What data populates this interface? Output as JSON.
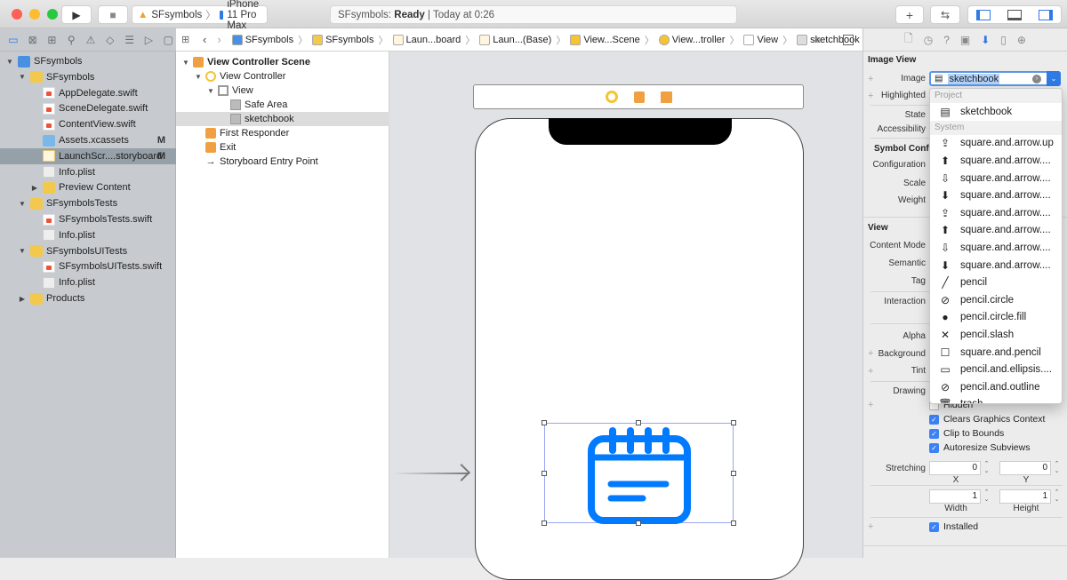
{
  "titlebar": {
    "scheme": {
      "project": "SFsymbols",
      "device": "iPhone 11 Pro Max"
    },
    "status": {
      "project": "SFsymbols:",
      "state": "Ready",
      "time": "| Today at 0:26"
    },
    "buttons": {
      "run": "▶",
      "stop": "■",
      "add": "+",
      "back_forward": "⇆"
    }
  },
  "navigator": {
    "items": [
      {
        "label": "SFsymbols",
        "icon": "project-icon",
        "level": 0,
        "disclosure": "▼"
      },
      {
        "label": "SFsymbols",
        "icon": "folder-icon",
        "level": 1,
        "disclosure": "▼"
      },
      {
        "label": "AppDelegate.swift",
        "icon": "swift-file-icon",
        "level": 2
      },
      {
        "label": "SceneDelegate.swift",
        "icon": "swift-file-icon",
        "level": 2
      },
      {
        "label": "ContentView.swift",
        "icon": "swift-file-icon",
        "level": 2
      },
      {
        "label": "Assets.xcassets",
        "icon": "assets-icon",
        "level": 2,
        "badge": "M"
      },
      {
        "label": "LaunchScr....storyboard",
        "icon": "storyboard-icon",
        "level": 2,
        "badge": "M",
        "selected": true
      },
      {
        "label": "Info.plist",
        "icon": "plist-icon",
        "level": 2
      },
      {
        "label": "Preview Content",
        "icon": "folder-icon",
        "level": 2,
        "disclosure": "▶"
      },
      {
        "label": "SFsymbolsTests",
        "icon": "folder-icon",
        "level": 1,
        "disclosure": "▼"
      },
      {
        "label": "SFsymbolsTests.swift",
        "icon": "swift-file-icon",
        "level": 2
      },
      {
        "label": "Info.plist",
        "icon": "plist-icon",
        "level": 2
      },
      {
        "label": "SFsymbolsUITests",
        "icon": "folder-icon",
        "level": 1,
        "disclosure": "▼"
      },
      {
        "label": "SFsymbolsUITests.swift",
        "icon": "swift-file-icon",
        "level": 2
      },
      {
        "label": "Info.plist",
        "icon": "plist-icon",
        "level": 2
      },
      {
        "label": "Products",
        "icon": "folder-icon",
        "level": 1,
        "disclosure": "▶"
      }
    ]
  },
  "jumpbar": {
    "crumbs": [
      "SFsymbols",
      "SFsymbols",
      "Laun...board",
      "Laun...(Base)",
      "View...Scene",
      "View...troller",
      "View",
      "sketchbook"
    ]
  },
  "outline": {
    "items": [
      {
        "label": "View Controller Scene",
        "bold": true,
        "disclosure": "▼"
      },
      {
        "label": "View Controller",
        "disclosure": "▼"
      },
      {
        "label": "View",
        "disclosure": "▼"
      },
      {
        "label": "Safe Area"
      },
      {
        "label": "sketchbook",
        "selected": true
      },
      {
        "label": "First Responder"
      },
      {
        "label": "Exit"
      },
      {
        "label": "Storyboard Entry Point"
      }
    ]
  },
  "inspector": {
    "image_view_header": "Image View",
    "labels": {
      "image": "Image",
      "highlighted": "Highlighted",
      "state": "State",
      "accessibility": "Accessibility",
      "symbol_config": "Symbol Config",
      "configuration": "Configuration",
      "scale": "Scale",
      "weight": "Weight",
      "view_header": "View",
      "content_mode": "Content Mode",
      "semantic": "Semantic",
      "tag": "Tag",
      "interaction": "Interaction",
      "alpha": "Alpha",
      "background": "Background",
      "tint": "Tint",
      "drawing": "Drawing",
      "stretching": "Stretching"
    },
    "image_value": "sketchbook",
    "checkboxes": [
      {
        "label": "Hidden",
        "checked": false
      },
      {
        "label": "Clears Graphics Context",
        "checked": true
      },
      {
        "label": "Clip to Bounds",
        "checked": true
      },
      {
        "label": "Autoresize Subviews",
        "checked": true
      }
    ],
    "stretching": {
      "x": "0",
      "y": "0",
      "width": "1",
      "height": "1",
      "x_label": "X",
      "y_label": "Y",
      "width_label": "Width",
      "height_label": "Height"
    },
    "installed": {
      "label": "Installed",
      "checked": true
    }
  },
  "dropdown": {
    "project_section": "Project",
    "project_items": [
      {
        "label": "sketchbook",
        "glyph": "▤"
      }
    ],
    "system_section": "System",
    "system_items": [
      {
        "label": "square.and.arrow.up",
        "glyph": "⇪"
      },
      {
        "label": "square.and.arrow....",
        "glyph": "⬆"
      },
      {
        "label": "square.and.arrow....",
        "glyph": "⇩"
      },
      {
        "label": "square.and.arrow....",
        "glyph": "⬇"
      },
      {
        "label": "square.and.arrow....",
        "glyph": "⇪"
      },
      {
        "label": "square.and.arrow....",
        "glyph": "⬆"
      },
      {
        "label": "square.and.arrow....",
        "glyph": "⇩"
      },
      {
        "label": "square.and.arrow....",
        "glyph": "⬇"
      },
      {
        "label": "pencil",
        "glyph": "╱"
      },
      {
        "label": "pencil.circle",
        "glyph": "⊘"
      },
      {
        "label": "pencil.circle.fill",
        "glyph": "●"
      },
      {
        "label": "pencil.slash",
        "glyph": "✕"
      },
      {
        "label": "square.and.pencil",
        "glyph": "☐"
      },
      {
        "label": "pencil.and.ellipsis....",
        "glyph": "▭"
      },
      {
        "label": "pencil.and.outline",
        "glyph": "⊘"
      },
      {
        "label": "trash",
        "glyph": "🗑"
      }
    ]
  },
  "colors": {
    "accent": "#007aff",
    "selection": "#96a0a8"
  }
}
